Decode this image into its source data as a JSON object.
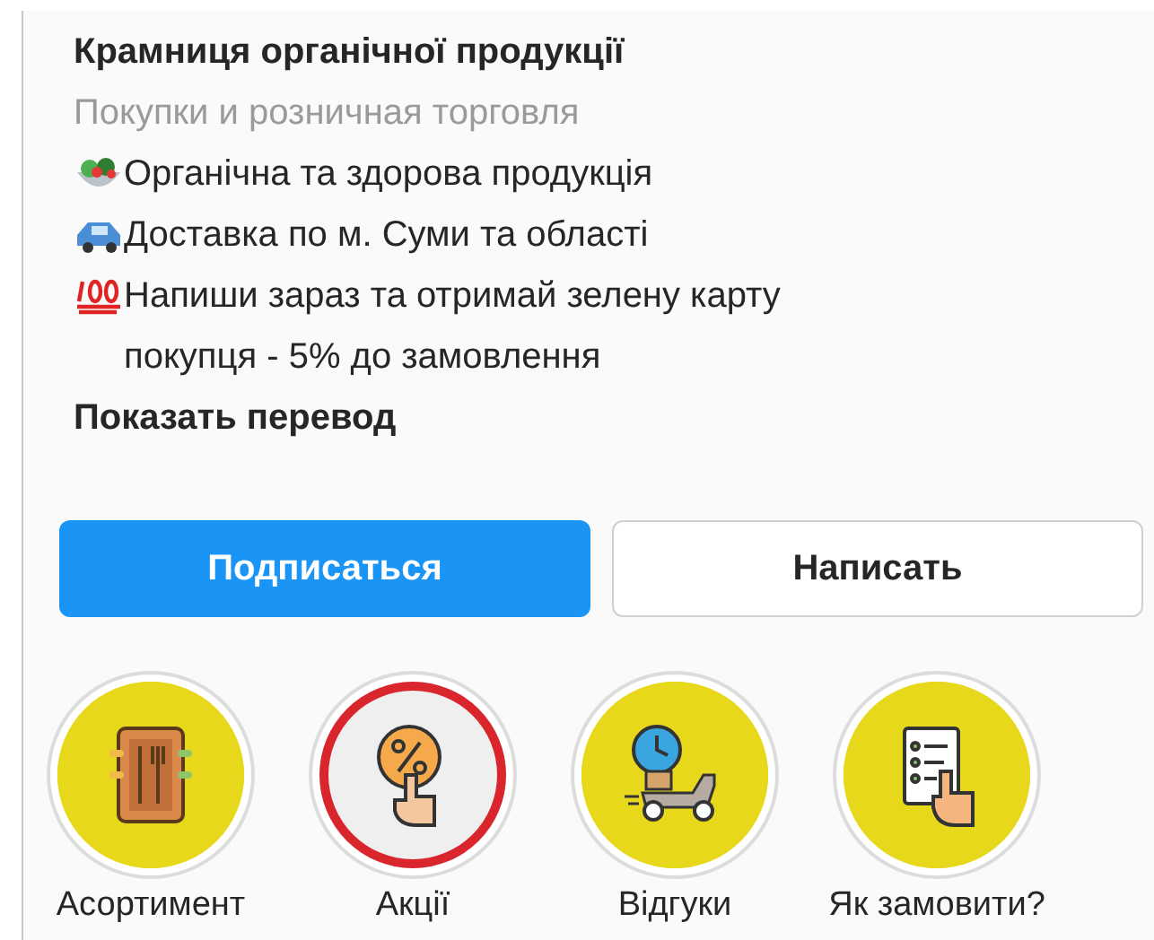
{
  "profile": {
    "name": "Крамниця органічної продукції",
    "category": "Покупки и розничная торговля",
    "bio": [
      "Органічна та здорова продукція",
      "Доставка по м. Суми та області",
      "Напиши зараз та отримай зелену карту покупця - 5% до замовлення"
    ],
    "translate_link": "Показать перевод"
  },
  "buttons": [
    {
      "label": "Подписаться",
      "kind": "primary"
    },
    {
      "label": "Написать",
      "kind": "secondary"
    }
  ],
  "highlights": [
    {
      "label": "Асортимент",
      "kind": "filled",
      "color": "#e8d81c"
    },
    {
      "label": "Акції",
      "kind": "outlined",
      "color": "#d9262c"
    },
    {
      "label": "Відгуки",
      "kind": "filled",
      "color": "#e8d81c"
    },
    {
      "label": "Як замовити?",
      "kind": "filled",
      "color": "#e8d81c"
    }
  ]
}
